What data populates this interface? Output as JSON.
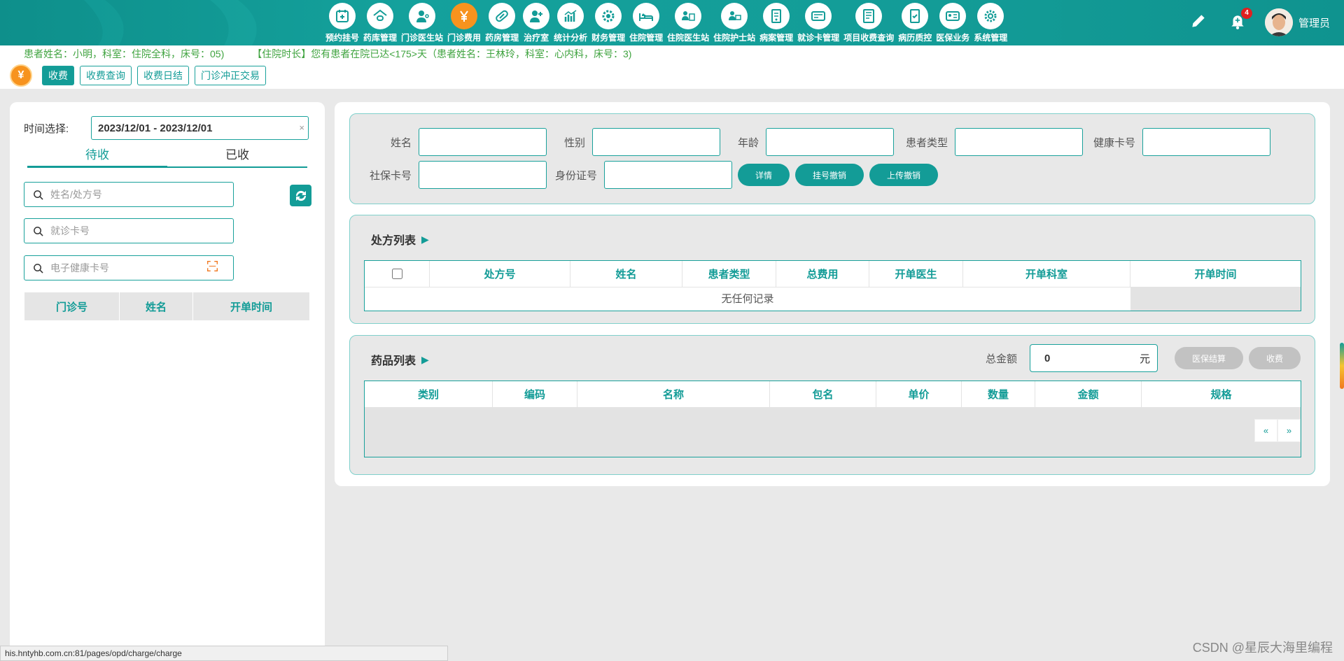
{
  "nav": {
    "items": [
      {
        "label": "预约挂号",
        "icon": "appointment-icon"
      },
      {
        "label": "药库管理",
        "icon": "warehouse-icon"
      },
      {
        "label": "门诊医生站",
        "icon": "doctor-icon"
      },
      {
        "label": "门诊费用",
        "icon": "yen-icon",
        "active": true
      },
      {
        "label": "药房管理",
        "icon": "pill-icon"
      },
      {
        "label": "治疗室",
        "icon": "treatment-icon"
      },
      {
        "label": "统计分析",
        "icon": "chart-icon"
      },
      {
        "label": "财务管理",
        "icon": "finance-icon"
      },
      {
        "label": "住院管理",
        "icon": "bed-icon"
      },
      {
        "label": "住院医生站",
        "icon": "inpatient-doctor-icon"
      },
      {
        "label": "住院护士站",
        "icon": "nurse-icon"
      },
      {
        "label": "病案管理",
        "icon": "record-icon"
      },
      {
        "label": "就诊卡管理",
        "icon": "card-icon"
      },
      {
        "label": "项目收费查询",
        "icon": "query-icon"
      },
      {
        "label": "病历质控",
        "icon": "quality-icon"
      },
      {
        "label": "医保业务",
        "icon": "insurance-icon"
      },
      {
        "label": "系统管理",
        "icon": "settings-icon"
      }
    ],
    "notification_count": "4",
    "user_name": "管理员"
  },
  "notice": {
    "text1": "患者姓名：小明，科室：住院全科，床号：05)",
    "text2": "【住院时长】您有患者在院已达<175>天（患者姓名：王林玲，科室：心内科，床号：3)"
  },
  "subtabs": {
    "coin": "¥",
    "items": [
      "收费",
      "收费查询",
      "收费日结",
      "门诊冲正交易"
    ]
  },
  "left": {
    "time_label": "时间选择:",
    "time_value": "2023/12/01 - 2023/12/01",
    "clear": "×",
    "tabs": [
      "待收",
      "已收"
    ],
    "search1_placeholder": "姓名/处方号",
    "search2_placeholder": "就诊卡号",
    "search3_placeholder": "电子健康卡号",
    "table_headers": [
      "门诊号",
      "姓名",
      "开单时间"
    ]
  },
  "form": {
    "labels": [
      "姓名",
      "性别",
      "年龄",
      "患者类型",
      "健康卡号",
      "社保卡号",
      "身份证号"
    ],
    "buttons": [
      "详情",
      "挂号撤销",
      "上传撤销"
    ]
  },
  "rx": {
    "title": "处方列表",
    "arrow": "▶",
    "headers": [
      "处方号",
      "姓名",
      "患者类型",
      "总费用",
      "开单医生",
      "开单科室",
      "开单时间"
    ],
    "empty": "无任何记录"
  },
  "drug": {
    "title": "药品列表",
    "arrow": "▶",
    "total_label": "总金额",
    "total_value": "0",
    "total_unit": "元",
    "buttons": [
      "医保结算",
      "收费"
    ],
    "headers": [
      "类别",
      "编码",
      "名称",
      "包名",
      "单价",
      "数量",
      "金额",
      "规格"
    ],
    "pager_prev": "«",
    "pager_next": "»"
  },
  "status_url": "his.hntyhb.com.cn:81/pages/opd/charge/charge",
  "watermark": "CSDN @星辰大海里编程",
  "colors": {
    "primary": "#139c97",
    "accent": "#f7931e",
    "alert": "#e02020",
    "notice": "#3fa33f"
  }
}
